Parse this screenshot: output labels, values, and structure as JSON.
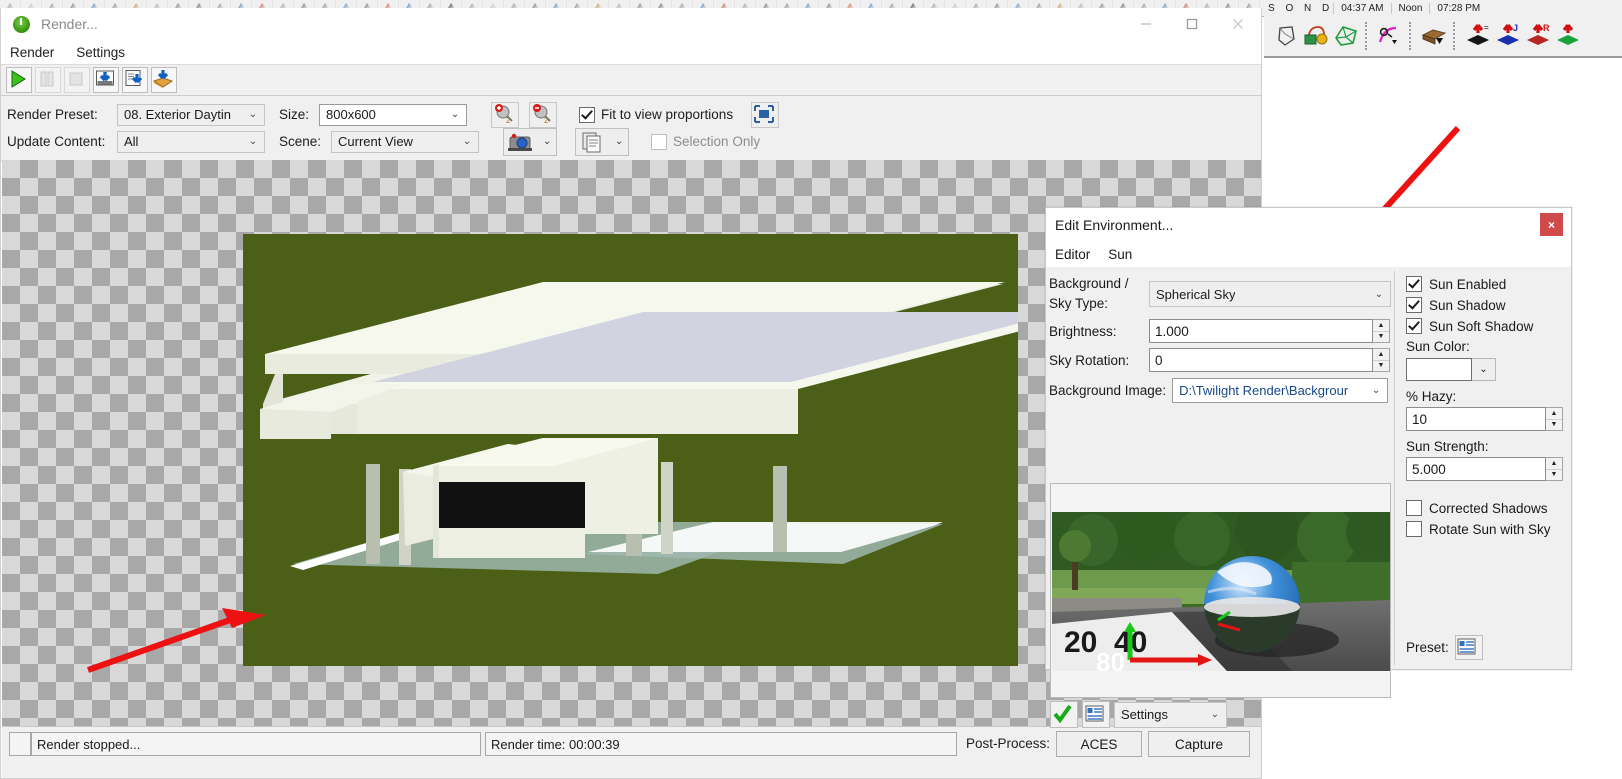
{
  "sketchup": {
    "shadow_bar": {
      "months": "S  O  N  D",
      "sunrise": "04:37 AM",
      "noon_label": "Noon",
      "sunset": "07:28 PM"
    },
    "toolbar_icons": [
      "solid-tools-icon",
      "sandbox-smoove-icon",
      "sandbox-from-contours-icon",
      "separator",
      "bezier-curve-icon",
      "separator",
      "push-wood-icon",
      "push-black-icon",
      "push-blue-icon",
      "push-red-icon",
      "push-green-icon"
    ]
  },
  "render_window": {
    "title": "Render...",
    "title_icon": "twilight-render-icon",
    "window_buttons": [
      "minimize-button",
      "maximize-button",
      "close-button"
    ],
    "menu": [
      "Render",
      "Settings"
    ],
    "toolbar": [
      {
        "name": "start-render-button",
        "icon": "play-icon",
        "enabled": true
      },
      {
        "name": "pause-render-button",
        "icon": "pause-icon",
        "enabled": false
      },
      {
        "name": "stop-render-button",
        "icon": "stop-icon",
        "enabled": false
      },
      {
        "name": "save-image-button",
        "icon": "save-image-icon",
        "enabled": true
      },
      {
        "name": "save-render-button",
        "icon": "save-document-icon",
        "enabled": true
      },
      {
        "name": "open-folder-button",
        "icon": "open-box-icon",
        "enabled": true
      }
    ],
    "options": {
      "render_preset_label": "Render Preset:",
      "render_preset_value": "08. Exterior Daytin",
      "size_label": "Size:",
      "size_value": "800x600",
      "update_content_label": "Update Content:",
      "update_content_value": "All",
      "scene_label": "Scene:",
      "scene_value": "Current View",
      "zoom_in_icon": "zoom-in-icon",
      "zoom_out_icon": "zoom-out-icon",
      "fit_to_view_label": "Fit to view proportions",
      "fit_to_view_checked": true,
      "fit_region_icon": "fit-region-icon",
      "camera_icon": "camera-icon",
      "pages_icon": "pages-icon",
      "selection_only_label": "Selection Only",
      "selection_only_checked": false
    },
    "status": {
      "message": "Render stopped...",
      "render_time": "Render time: 00:00:39",
      "post_process_label": "Post-Process:",
      "aces_button": "ACES",
      "capture_button": "Capture"
    }
  },
  "env_dialog": {
    "title": "Edit Environment...",
    "close_label": "×",
    "menu": [
      "Editor",
      "Sun"
    ],
    "fields": {
      "sky_type_label_line1": "Background /",
      "sky_type_label_line2": "Sky Type:",
      "sky_type_value": "Spherical Sky",
      "brightness_label": "Brightness:",
      "brightness_value": "1.000",
      "sky_rotation_label": "Sky Rotation:",
      "sky_rotation_value": "0",
      "background_image_label": "Background Image:",
      "background_image_value": "D:\\Twilight Render\\Backgrour"
    },
    "preview": {
      "apply_icon": "green-check-icon",
      "list_icon": "list-icon",
      "settings_value": "Settings"
    },
    "sun": {
      "sun_enabled_label": "Sun Enabled",
      "sun_enabled_checked": true,
      "sun_shadow_label": "Sun Shadow",
      "sun_shadow_checked": true,
      "sun_soft_shadow_label": "Sun Soft Shadow",
      "sun_soft_shadow_checked": true,
      "sun_color_label": "Sun Color:",
      "sun_color_value": "#ffffff",
      "hazy_label": "% Hazy:",
      "hazy_value": "10",
      "sun_strength_label": "Sun Strength:",
      "sun_strength_value": "5.000",
      "corrected_shadows_label": "Corrected Shadows",
      "corrected_shadows_checked": false,
      "rotate_sun_label": "Rotate Sun with Sky",
      "rotate_sun_checked": false,
      "preset_label": "Preset:",
      "preset_icon": "preset-icon"
    }
  },
  "annotations": {
    "arrow_color": "#ee1111",
    "arrows": [
      "arrow-pointing-sky-type-dropdown",
      "arrow-pointing-render-background"
    ]
  }
}
